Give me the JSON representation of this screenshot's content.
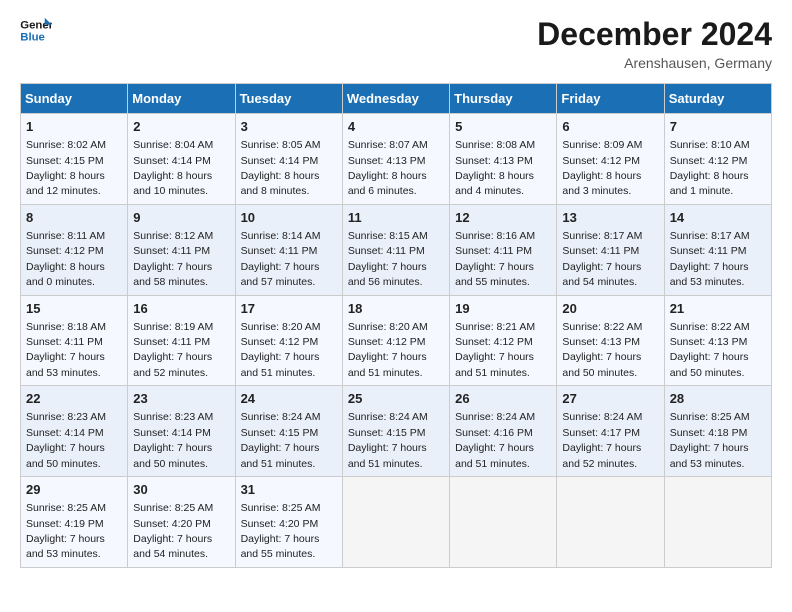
{
  "header": {
    "logo_line1": "General",
    "logo_line2": "Blue",
    "month_year": "December 2024",
    "location": "Arenshausen, Germany"
  },
  "days_of_week": [
    "Sunday",
    "Monday",
    "Tuesday",
    "Wednesday",
    "Thursday",
    "Friday",
    "Saturday"
  ],
  "weeks": [
    [
      {
        "day": 1,
        "sunrise": "8:02 AM",
        "sunset": "4:15 PM",
        "daylight": "8 hours and 12 minutes."
      },
      {
        "day": 2,
        "sunrise": "8:04 AM",
        "sunset": "4:14 PM",
        "daylight": "8 hours and 10 minutes."
      },
      {
        "day": 3,
        "sunrise": "8:05 AM",
        "sunset": "4:14 PM",
        "daylight": "8 hours and 8 minutes."
      },
      {
        "day": 4,
        "sunrise": "8:07 AM",
        "sunset": "4:13 PM",
        "daylight": "8 hours and 6 minutes."
      },
      {
        "day": 5,
        "sunrise": "8:08 AM",
        "sunset": "4:13 PM",
        "daylight": "8 hours and 4 minutes."
      },
      {
        "day": 6,
        "sunrise": "8:09 AM",
        "sunset": "4:12 PM",
        "daylight": "8 hours and 3 minutes."
      },
      {
        "day": 7,
        "sunrise": "8:10 AM",
        "sunset": "4:12 PM",
        "daylight": "8 hours and 1 minute."
      }
    ],
    [
      {
        "day": 8,
        "sunrise": "8:11 AM",
        "sunset": "4:12 PM",
        "daylight": "8 hours and 0 minutes."
      },
      {
        "day": 9,
        "sunrise": "8:12 AM",
        "sunset": "4:11 PM",
        "daylight": "7 hours and 58 minutes."
      },
      {
        "day": 10,
        "sunrise": "8:14 AM",
        "sunset": "4:11 PM",
        "daylight": "7 hours and 57 minutes."
      },
      {
        "day": 11,
        "sunrise": "8:15 AM",
        "sunset": "4:11 PM",
        "daylight": "7 hours and 56 minutes."
      },
      {
        "day": 12,
        "sunrise": "8:16 AM",
        "sunset": "4:11 PM",
        "daylight": "7 hours and 55 minutes."
      },
      {
        "day": 13,
        "sunrise": "8:17 AM",
        "sunset": "4:11 PM",
        "daylight": "7 hours and 54 minutes."
      },
      {
        "day": 14,
        "sunrise": "8:17 AM",
        "sunset": "4:11 PM",
        "daylight": "7 hours and 53 minutes."
      }
    ],
    [
      {
        "day": 15,
        "sunrise": "8:18 AM",
        "sunset": "4:11 PM",
        "daylight": "7 hours and 53 minutes."
      },
      {
        "day": 16,
        "sunrise": "8:19 AM",
        "sunset": "4:11 PM",
        "daylight": "7 hours and 52 minutes."
      },
      {
        "day": 17,
        "sunrise": "8:20 AM",
        "sunset": "4:12 PM",
        "daylight": "7 hours and 51 minutes."
      },
      {
        "day": 18,
        "sunrise": "8:20 AM",
        "sunset": "4:12 PM",
        "daylight": "7 hours and 51 minutes."
      },
      {
        "day": 19,
        "sunrise": "8:21 AM",
        "sunset": "4:12 PM",
        "daylight": "7 hours and 51 minutes."
      },
      {
        "day": 20,
        "sunrise": "8:22 AM",
        "sunset": "4:13 PM",
        "daylight": "7 hours and 50 minutes."
      },
      {
        "day": 21,
        "sunrise": "8:22 AM",
        "sunset": "4:13 PM",
        "daylight": "7 hours and 50 minutes."
      }
    ],
    [
      {
        "day": 22,
        "sunrise": "8:23 AM",
        "sunset": "4:14 PM",
        "daylight": "7 hours and 50 minutes."
      },
      {
        "day": 23,
        "sunrise": "8:23 AM",
        "sunset": "4:14 PM",
        "daylight": "7 hours and 50 minutes."
      },
      {
        "day": 24,
        "sunrise": "8:24 AM",
        "sunset": "4:15 PM",
        "daylight": "7 hours and 51 minutes."
      },
      {
        "day": 25,
        "sunrise": "8:24 AM",
        "sunset": "4:15 PM",
        "daylight": "7 hours and 51 minutes."
      },
      {
        "day": 26,
        "sunrise": "8:24 AM",
        "sunset": "4:16 PM",
        "daylight": "7 hours and 51 minutes."
      },
      {
        "day": 27,
        "sunrise": "8:24 AM",
        "sunset": "4:17 PM",
        "daylight": "7 hours and 52 minutes."
      },
      {
        "day": 28,
        "sunrise": "8:25 AM",
        "sunset": "4:18 PM",
        "daylight": "7 hours and 53 minutes."
      }
    ],
    [
      {
        "day": 29,
        "sunrise": "8:25 AM",
        "sunset": "4:19 PM",
        "daylight": "7 hours and 53 minutes."
      },
      {
        "day": 30,
        "sunrise": "8:25 AM",
        "sunset": "4:20 PM",
        "daylight": "7 hours and 54 minutes."
      },
      {
        "day": 31,
        "sunrise": "8:25 AM",
        "sunset": "4:20 PM",
        "daylight": "7 hours and 55 minutes."
      },
      null,
      null,
      null,
      null
    ]
  ]
}
